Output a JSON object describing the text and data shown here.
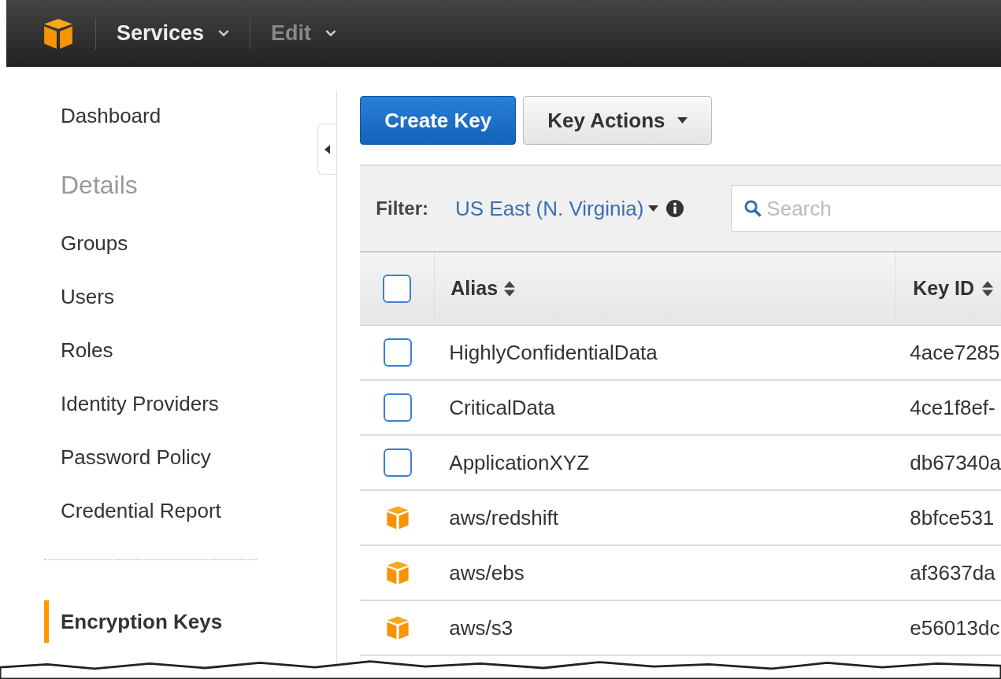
{
  "top_bar": {
    "menus": [
      {
        "label": "Services",
        "disabled": false
      },
      {
        "label": "Edit",
        "disabled": true
      }
    ]
  },
  "sidebar": {
    "items": [
      {
        "kind": "link",
        "label": "Dashboard",
        "selected": false
      },
      {
        "kind": "heading",
        "label": "Details"
      },
      {
        "kind": "link",
        "label": "Groups",
        "selected": false
      },
      {
        "kind": "link",
        "label": "Users",
        "selected": false
      },
      {
        "kind": "link",
        "label": "Roles",
        "selected": false
      },
      {
        "kind": "link",
        "label": "Identity Providers",
        "selected": false
      },
      {
        "kind": "link",
        "label": "Password Policy",
        "selected": false
      },
      {
        "kind": "link",
        "label": "Credential Report",
        "selected": false
      },
      {
        "kind": "divider"
      },
      {
        "kind": "link",
        "label": "Encryption Keys",
        "selected": true
      }
    ]
  },
  "toolbar": {
    "primary_button": "Create Key",
    "actions_button": "Key Actions"
  },
  "filter": {
    "label": "Filter:",
    "region": "US East (N. Virginia)",
    "search_placeholder": "Search"
  },
  "table": {
    "select_all_checked": false,
    "columns": [
      "Alias",
      "Key ID"
    ],
    "rows": [
      {
        "kind": "checkbox",
        "checked": false,
        "alias": "HighlyConfidentialData",
        "key_id": "4ace7285"
      },
      {
        "kind": "checkbox",
        "checked": false,
        "alias": "CriticalData",
        "key_id": "4ce1f8ef-"
      },
      {
        "kind": "checkbox",
        "checked": false,
        "alias": "ApplicationXYZ",
        "key_id": "db67340a"
      },
      {
        "kind": "aws",
        "alias": "aws/redshift",
        "key_id": "8bfce531"
      },
      {
        "kind": "aws",
        "alias": "aws/ebs",
        "key_id": "af3637da"
      },
      {
        "kind": "aws",
        "alias": "aws/s3",
        "key_id": "e56013dc"
      }
    ]
  }
}
